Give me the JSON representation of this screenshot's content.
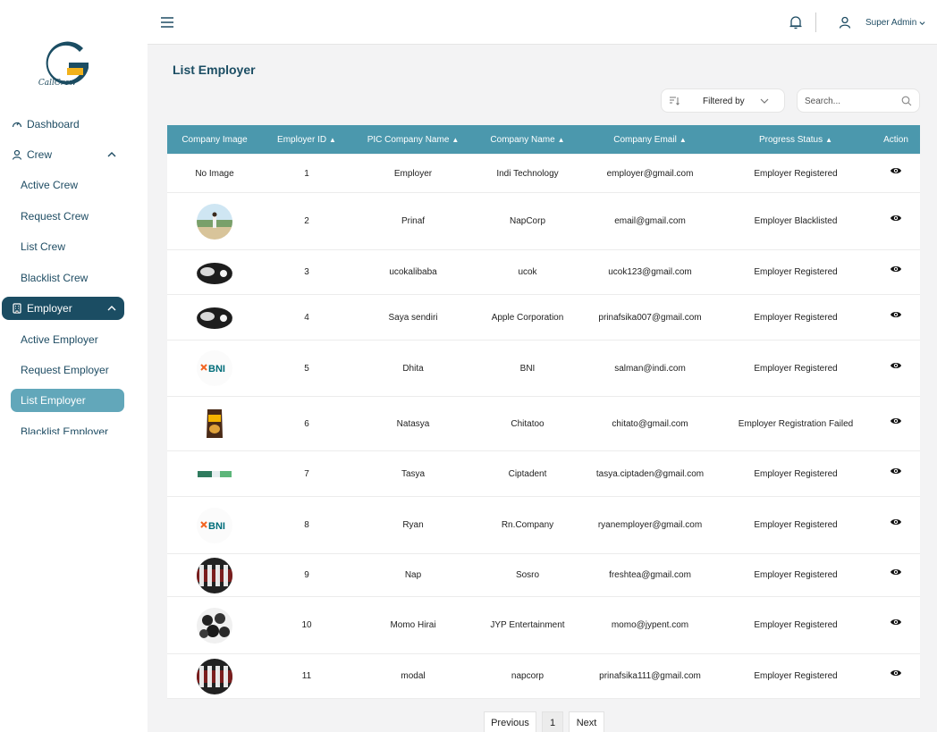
{
  "brand": {
    "logo_text": "CallCrew"
  },
  "sidebar": {
    "items": [
      {
        "label": "Dashboard",
        "icon": "gauge-icon"
      },
      {
        "label": "Crew",
        "icon": "user-icon"
      },
      {
        "label": "Active Crew"
      },
      {
        "label": "Request Crew"
      },
      {
        "label": "List Crew"
      },
      {
        "label": "Blacklist Crew"
      },
      {
        "label": "Employer",
        "icon": "building-icon"
      },
      {
        "label": "Active Employer"
      },
      {
        "label": "Request Employer"
      },
      {
        "label": "List Employer"
      },
      {
        "label": "Blacklist Employer"
      }
    ]
  },
  "topbar": {
    "user_name": "Super Admin"
  },
  "page": {
    "title": "List Employer"
  },
  "filter": {
    "label": "Filtered by"
  },
  "search": {
    "placeholder": "Search..."
  },
  "table": {
    "columns": [
      "Company Image",
      "Employer ID",
      "PIC Company Name",
      "Company Name",
      "Company Email",
      "Progress Status",
      "Action"
    ],
    "sortable": [
      false,
      true,
      true,
      true,
      true,
      true,
      false
    ],
    "rows": [
      {
        "image": "No Image",
        "image_kind": "none",
        "id": "1",
        "pic": "Employer",
        "company": "Indi Technology",
        "email": "employer@gmail.com",
        "status": "Employer Registered"
      },
      {
        "image": "",
        "image_kind": "landscape",
        "id": "2",
        "pic": "Prinaf",
        "company": "NapCorp",
        "email": "email@gmail.com",
        "status": "Employer Blacklisted"
      },
      {
        "image": "",
        "image_kind": "apple",
        "id": "3",
        "pic": "ucokalibaba",
        "company": "ucok",
        "email": "ucok123@gmail.com",
        "status": "Employer Registered"
      },
      {
        "image": "",
        "image_kind": "apple",
        "id": "4",
        "pic": "Saya sendiri",
        "company": "Apple Corporation",
        "email": "prinafsika007@gmail.com",
        "status": "Employer Registered"
      },
      {
        "image": "BNI",
        "image_kind": "bni",
        "id": "5",
        "pic": "Dhita",
        "company": "BNI",
        "email": "salman@indi.com",
        "status": "Employer Registered"
      },
      {
        "image": "",
        "image_kind": "snack",
        "id": "6",
        "pic": "Natasya",
        "company": "Chitatoo",
        "email": "chitato@gmail.com",
        "status": "Employer Registration Failed"
      },
      {
        "image": "",
        "image_kind": "toothpaste",
        "id": "7",
        "pic": "Tasya",
        "company": "Ciptadent",
        "email": "tasya.ciptaden@gmail.com",
        "status": "Employer Registered"
      },
      {
        "image": "BNI",
        "image_kind": "bni",
        "id": "8",
        "pic": "Ryan",
        "company": "Rn.Company",
        "email": "ryanemployer@gmail.com",
        "status": "Employer Registered"
      },
      {
        "image": "",
        "image_kind": "bottles",
        "id": "9",
        "pic": "Nap",
        "company": "Sosro",
        "email": "freshtea@gmail.com",
        "status": "Employer Registered"
      },
      {
        "image": "",
        "image_kind": "group",
        "id": "10",
        "pic": "Momo Hirai",
        "company": "JYP Entertainment",
        "email": "momo@jypent.com",
        "status": "Employer Registered"
      },
      {
        "image": "",
        "image_kind": "bottles",
        "id": "11",
        "pic": "modal",
        "company": "napcorp",
        "email": "prinafsika111@gmail.com",
        "status": "Employer Registered"
      }
    ]
  },
  "pagination": {
    "previous": "Previous",
    "current": "1",
    "next": "Next"
  },
  "colors": {
    "primary": "#1b4d63",
    "table_header": "#4b98ad",
    "active_sub": "#62a7ba",
    "logo_yellow": "#f2b21c"
  }
}
